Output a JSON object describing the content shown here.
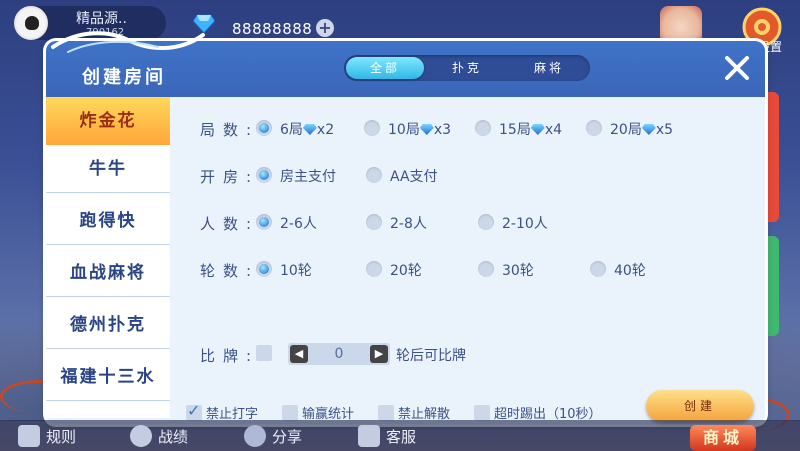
{
  "user": {
    "name": "精品源..",
    "id": "790162"
  },
  "currency": {
    "diamonds": "88888888",
    "plus": "+",
    "icon": "diamond-icon"
  },
  "top_right": {
    "settings_label": "設置"
  },
  "dialog": {
    "title": "创建房间",
    "tabs": [
      "全部",
      "扑克",
      "麻将"
    ],
    "active_tab": "全部",
    "close_icon": "close-icon"
  },
  "games": [
    "炸金花",
    "牛牛",
    "跑得快",
    "血战麻将",
    "德州扑克",
    "福建十三水"
  ],
  "active_game": "炸金花",
  "rows": {
    "rounds": {
      "label": "局数:",
      "options": [
        {
          "text": "6局",
          "cost": "x2",
          "selected": true
        },
        {
          "text": "10局",
          "cost": "x3",
          "selected": false
        },
        {
          "text": "15局",
          "cost": "x4",
          "selected": false
        },
        {
          "text": "20局",
          "cost": "x5",
          "selected": false
        }
      ]
    },
    "payment": {
      "label": "开房:",
      "options": [
        {
          "text": "房主支付",
          "selected": true
        },
        {
          "text": "AA支付",
          "selected": false
        }
      ]
    },
    "players": {
      "label": "人数:",
      "options": [
        {
          "text": "2-6人",
          "selected": true
        },
        {
          "text": "2-8人",
          "selected": false
        },
        {
          "text": "2-10人",
          "selected": false
        }
      ]
    },
    "turns": {
      "label": "轮数:",
      "options": [
        {
          "text": "10轮",
          "selected": true
        },
        {
          "text": "20轮",
          "selected": false
        },
        {
          "text": "30轮",
          "selected": false
        },
        {
          "text": "40轮",
          "selected": false
        }
      ]
    },
    "compare": {
      "label": "比牌:",
      "value": "0",
      "suffix": "轮后可比牌",
      "dec": "◀",
      "inc": "▶"
    }
  },
  "checkboxes": [
    {
      "text": "禁止打字",
      "checked": true
    },
    {
      "text": "输赢统计",
      "checked": false
    },
    {
      "text": "禁止解散",
      "checked": false
    },
    {
      "text": "超时踢出（10秒）",
      "checked": false
    }
  ],
  "create_label": "创建",
  "bottom": {
    "rules": "规则",
    "record": "战绩",
    "share": "分享",
    "service": "客服",
    "shop": "商城"
  }
}
